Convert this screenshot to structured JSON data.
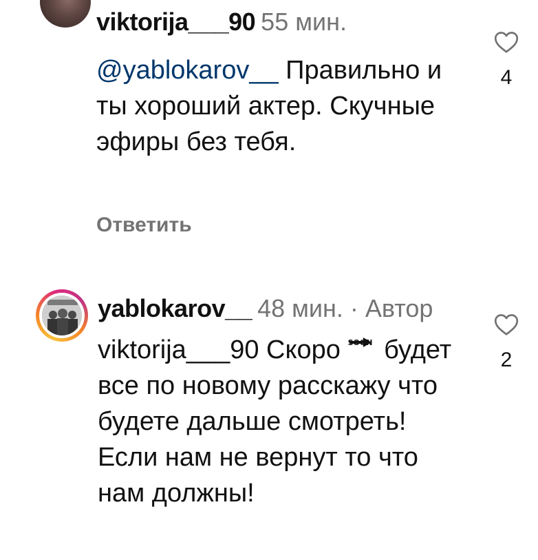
{
  "comments": [
    {
      "username": "viktorija___90",
      "timestamp": "55 мин.",
      "mention": "@yablokarov__",
      "text": "Правильно и ты хороший актер. Скучные эфиры без тебя.",
      "reply_label": "Ответить",
      "like_count": "4",
      "icon": "heart-outline-icon"
    },
    {
      "username": "yablokarov__",
      "timestamp": "48 мин. · Автор",
      "mention": "viktorija___90",
      "text_before_emoji": "Скоро",
      "emoji": "soon-arrow-emoji",
      "emoji_label": "SOON",
      "text_after_emoji": "будет все по новому расскажу что будете дальше смотреть! Если нам не вернут то что нам должны!",
      "like_count": "2",
      "icon": "heart-outline-icon"
    }
  ],
  "colors": {
    "text": "#111111",
    "secondary": "#737373",
    "mention": "#00376b",
    "story_ring": [
      "#f9c23c",
      "#f58529",
      "#dd2a7b",
      "#c13584"
    ]
  }
}
